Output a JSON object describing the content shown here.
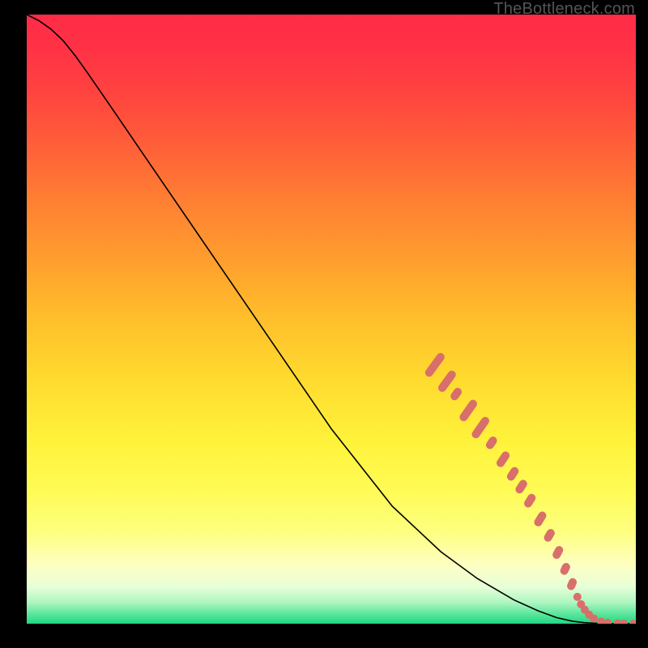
{
  "watermark": "TheBottleneck.com",
  "chart_data": {
    "type": "line",
    "title": "",
    "xlabel": "",
    "ylabel": "",
    "xlim": [
      0,
      100
    ],
    "ylim": [
      0,
      100
    ],
    "background_gradient": {
      "stops": [
        {
          "offset": 0.0,
          "color": "#ff2b47"
        },
        {
          "offset": 0.06,
          "color": "#ff3345"
        },
        {
          "offset": 0.12,
          "color": "#ff4140"
        },
        {
          "offset": 0.2,
          "color": "#ff5a3a"
        },
        {
          "offset": 0.3,
          "color": "#ff7d33"
        },
        {
          "offset": 0.4,
          "color": "#ff9d2e"
        },
        {
          "offset": 0.5,
          "color": "#ffbf2b"
        },
        {
          "offset": 0.6,
          "color": "#ffdb2f"
        },
        {
          "offset": 0.7,
          "color": "#fff23b"
        },
        {
          "offset": 0.78,
          "color": "#fffb55"
        },
        {
          "offset": 0.85,
          "color": "#feff80"
        },
        {
          "offset": 0.905,
          "color": "#fdffc3"
        },
        {
          "offset": 0.94,
          "color": "#e6ffd7"
        },
        {
          "offset": 0.965,
          "color": "#aef6c1"
        },
        {
          "offset": 0.985,
          "color": "#57e59a"
        },
        {
          "offset": 1.0,
          "color": "#1fd884"
        }
      ]
    },
    "series": [
      {
        "name": "curve",
        "color": "#000000",
        "stroke_width": 1.6,
        "x": [
          0.0,
          2.0,
          4.0,
          6.0,
          8.0,
          10.0,
          14.0,
          20.0,
          30.0,
          40.0,
          50.0,
          60.0,
          68.0,
          74.0,
          80.0,
          84.0,
          87.0,
          89.5,
          91.5,
          93.0,
          95.0,
          97.0,
          100.0
        ],
        "y": [
          100.0,
          99.0,
          97.6,
          95.7,
          93.2,
          90.4,
          84.6,
          75.8,
          61.2,
          46.6,
          32.0,
          19.3,
          11.8,
          7.4,
          3.9,
          2.1,
          1.0,
          0.42,
          0.18,
          0.09,
          0.03,
          0.01,
          0.0
        ]
      }
    ],
    "markers": [
      {
        "type": "dash",
        "cx": 67.0,
        "cy": 42.5,
        "angle": -54,
        "len": 4.5
      },
      {
        "type": "dash",
        "cx": 69.0,
        "cy": 39.8,
        "angle": -54,
        "len": 4.0
      },
      {
        "type": "dash",
        "cx": 70.5,
        "cy": 37.7,
        "angle": -54,
        "len": 2.2
      },
      {
        "type": "dash",
        "cx": 72.5,
        "cy": 35.0,
        "angle": -55,
        "len": 4.0
      },
      {
        "type": "dash",
        "cx": 74.5,
        "cy": 32.2,
        "angle": -55,
        "len": 4.0
      },
      {
        "type": "dash",
        "cx": 76.3,
        "cy": 29.7,
        "angle": -56,
        "len": 2.2
      },
      {
        "type": "dash",
        "cx": 78.2,
        "cy": 27.0,
        "angle": -56,
        "len": 2.8
      },
      {
        "type": "dash",
        "cx": 79.8,
        "cy": 24.6,
        "angle": -57,
        "len": 2.4
      },
      {
        "type": "dash",
        "cx": 81.2,
        "cy": 22.5,
        "angle": -57,
        "len": 2.4
      },
      {
        "type": "dash",
        "cx": 82.6,
        "cy": 20.2,
        "angle": -58,
        "len": 2.4
      },
      {
        "type": "dash",
        "cx": 84.3,
        "cy": 17.2,
        "angle": -59,
        "len": 2.6
      },
      {
        "type": "dash",
        "cx": 85.8,
        "cy": 14.5,
        "angle": -60,
        "len": 2.2
      },
      {
        "type": "dash",
        "cx": 87.2,
        "cy": 11.7,
        "angle": -62,
        "len": 2.2
      },
      {
        "type": "dash",
        "cx": 88.4,
        "cy": 9.0,
        "angle": -64,
        "len": 2.0
      },
      {
        "type": "dash",
        "cx": 89.5,
        "cy": 6.5,
        "angle": -67,
        "len": 2.0
      },
      {
        "type": "dot",
        "cx": 90.4,
        "cy": 4.4
      },
      {
        "type": "dot",
        "cx": 91.0,
        "cy": 3.2
      },
      {
        "type": "dot",
        "cx": 91.6,
        "cy": 2.3
      },
      {
        "type": "dot",
        "cx": 92.3,
        "cy": 1.5
      },
      {
        "type": "dot",
        "cx": 93.1,
        "cy": 0.85
      },
      {
        "type": "dot",
        "cx": 94.3,
        "cy": 0.35
      },
      {
        "type": "dot",
        "cx": 95.4,
        "cy": 0.15
      },
      {
        "type": "dot",
        "cx": 97.0,
        "cy": 0.05
      },
      {
        "type": "dot",
        "cx": 98.0,
        "cy": 0.03
      },
      {
        "type": "dot",
        "cx": 99.6,
        "cy": 0.0
      }
    ],
    "marker_style": {
      "color": "#d86f6a",
      "dash_thickness": 10,
      "dot_radius": 5
    }
  }
}
